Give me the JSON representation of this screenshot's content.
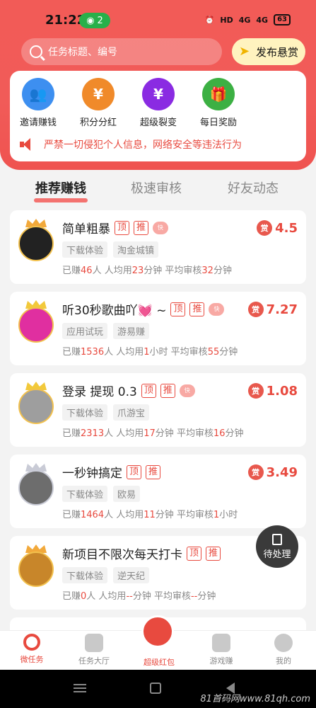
{
  "status": {
    "time": "21:22",
    "wifi_count": "2",
    "battery": "63"
  },
  "search": {
    "placeholder": "任务标题、编号"
  },
  "publish": {
    "label": "发布悬赏"
  },
  "features": [
    {
      "label": "邀请赚钱",
      "icon": "invite-icon",
      "color": "#3d8ff0"
    },
    {
      "label": "积分分红",
      "icon": "points-icon",
      "color": "#f08a2a"
    },
    {
      "label": "超级裂变",
      "icon": "yuan-icon",
      "color": "#8a2be2"
    },
    {
      "label": "每日奖励",
      "icon": "gift-icon",
      "color": "#3cb043"
    }
  ],
  "notice": "严禁一切侵犯个人信息，网络安全等违法行为",
  "tabs": [
    "推荐赚钱",
    "极速审核",
    "好友动态"
  ],
  "tasks": [
    {
      "title": "简单粗暴",
      "badges": [
        "顶",
        "推"
      ],
      "reward": "4.5",
      "tags": [
        "下载体验",
        "淘金城镇"
      ],
      "earned_prefix": "已赚",
      "earned": "46",
      "per_label": "人  人均用",
      "avg": "23",
      "avg_unit": "分钟",
      "review_label": "  平均审核",
      "review": "32",
      "review_unit": "分钟"
    },
    {
      "title": "听30秒歌曲吖💓 ~",
      "badges": [
        "顶",
        "推"
      ],
      "reward": "7.27",
      "tags": [
        "应用试玩",
        "游易赚"
      ],
      "earned_prefix": "已赚",
      "earned": "1536",
      "per_label": "人  人均用",
      "avg": "1",
      "avg_unit": "小时",
      "review_label": "  平均审核",
      "review": "55",
      "review_unit": "分钟"
    },
    {
      "title": "登录 提现  0.3",
      "badges": [
        "顶",
        "推"
      ],
      "reward": "1.08",
      "tags": [
        "下载体验",
        "爪游宝"
      ],
      "earned_prefix": "已赚",
      "earned": "2313",
      "per_label": "人  人均用",
      "avg": "17",
      "avg_unit": "分钟",
      "review_label": "  平均审核",
      "review": "16",
      "review_unit": "分钟"
    },
    {
      "title": "一秒钟搞定",
      "badges": [
        "顶",
        "推"
      ],
      "reward": "3.49",
      "tags": [
        "下载体验",
        "欧易"
      ],
      "earned_prefix": "已赚",
      "earned": "1464",
      "per_label": "人  人均用",
      "avg": "11",
      "avg_unit": "分钟",
      "review_label": "  平均审核",
      "review": "1",
      "review_unit": "小时"
    },
    {
      "title": "新项目不限次每天打卡",
      "badges": [
        "顶",
        "推"
      ],
      "reward": "",
      "tags": [
        "下载体验",
        "逆天纪"
      ],
      "earned_prefix": "已赚",
      "earned": "0",
      "per_label": "人  人均用",
      "avg": "--",
      "avg_unit": "分钟",
      "review_label": "  平均审核",
      "review": "--",
      "review_unit": "分钟"
    }
  ],
  "float_button": {
    "label": "待处理"
  },
  "bottom_nav": [
    "微任务",
    "任务大厅",
    "超级红包",
    "游戏赚",
    "我的"
  ],
  "watermark": "81首码网www.81qh.com"
}
